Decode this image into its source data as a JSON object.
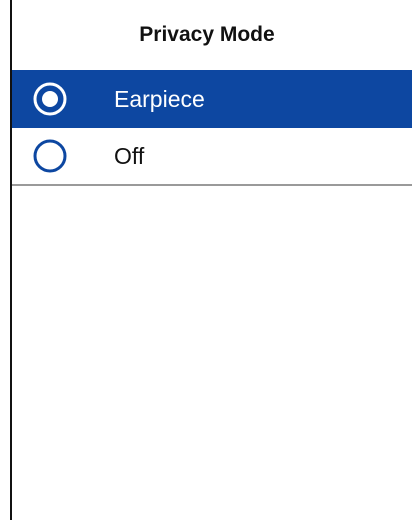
{
  "header": {
    "title": "Privacy Mode"
  },
  "options": [
    {
      "label": "Earpiece",
      "selected": true
    },
    {
      "label": "Off",
      "selected": false
    }
  ],
  "colors": {
    "accent": "#0d47a1",
    "selected_text": "#ffffff",
    "text": "#111111",
    "divider": "#9a9a9a",
    "radio_ring_unselected": "#0d47a1",
    "radio_selected": "#ffffff"
  },
  "icons": {
    "selected_radio": "radio-selected-icon",
    "unselected_radio": "radio-unselected-icon"
  }
}
